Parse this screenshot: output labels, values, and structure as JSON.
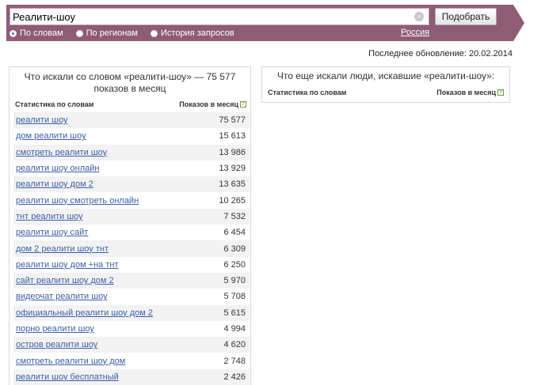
{
  "search": {
    "query": "Реалити-шоу",
    "submit_label": "Подобрать",
    "modes": [
      {
        "label": "По словам",
        "checked": true
      },
      {
        "label": "По регионам",
        "checked": false
      },
      {
        "label": "История запросов",
        "checked": false
      }
    ],
    "region": "Россия"
  },
  "updated": "Последнее обновление: 20.02.2014",
  "left_panel": {
    "title": "Что искали со словом «реалити-шоу» — 75 577 показов в месяц",
    "col_left": "Статистика по словам",
    "col_right": "Показов в месяц",
    "help_icon": "?",
    "rows": [
      {
        "phrase": "реалити шоу",
        "count": "75 577"
      },
      {
        "phrase": "дом реалити шоу",
        "count": "15 613"
      },
      {
        "phrase": "смотреть реалити шоу",
        "count": "13 986"
      },
      {
        "phrase": "реалити шоу онлайн",
        "count": "13 929"
      },
      {
        "phrase": "реалити шоу дом 2",
        "count": "13 635"
      },
      {
        "phrase": "реалити шоу смотреть онлайн",
        "count": "10 265"
      },
      {
        "phrase": "тнт реалити шоу",
        "count": "7 532"
      },
      {
        "phrase": "реалити шоу сайт",
        "count": "6 454"
      },
      {
        "phrase": "дом 2 реалити шоу тнт",
        "count": "6 309"
      },
      {
        "phrase": "реалити шоу дом +на тнт",
        "count": "6 250"
      },
      {
        "phrase": "сайт реалити шоу дом 2",
        "count": "5 970"
      },
      {
        "phrase": "видеочат реалити шоу",
        "count": "5 708"
      },
      {
        "phrase": "официальный реалити шоу дом 2",
        "count": "5 615"
      },
      {
        "phrase": "порно реалити шоу",
        "count": "4 994"
      },
      {
        "phrase": "остров реалити шоу",
        "count": "4 620"
      },
      {
        "phrase": "смотреть реалити шоу дом",
        "count": "2 748"
      },
      {
        "phrase": "реалити шоу бесплатный",
        "count": "2 426"
      }
    ]
  },
  "right_panel": {
    "title": "Что еще искали люди, искавшие «реалити-шоу»:",
    "col_left": "Статистика по словам",
    "col_right": "Показов в месяц",
    "help_icon": "?"
  },
  "colors": {
    "band": "#8e5c74",
    "link": "#3a5ea7",
    "help": "#6b9a3c"
  }
}
